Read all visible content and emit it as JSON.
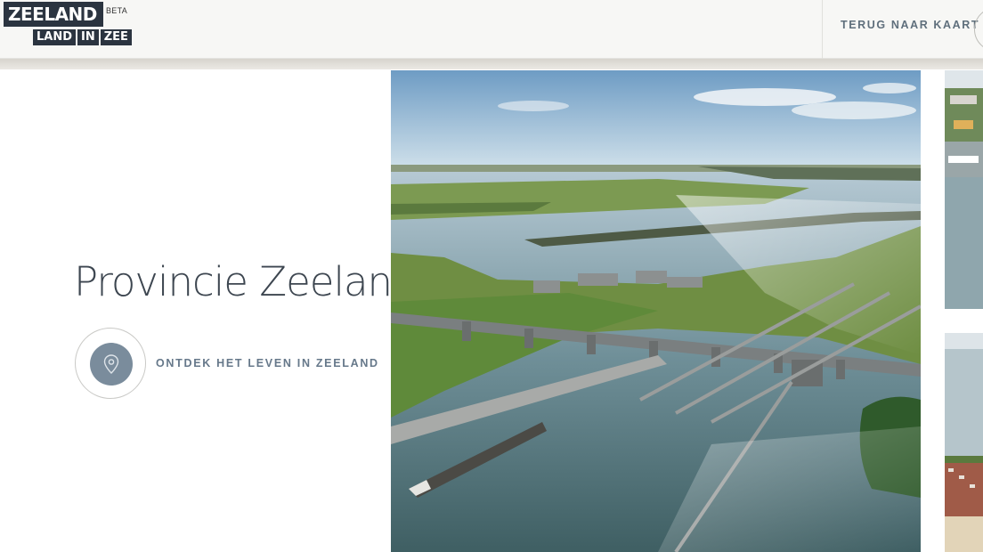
{
  "header": {
    "logo": {
      "top": "ZEELAND",
      "beta": "BETA",
      "words": [
        "LAND",
        "IN",
        "ZEE"
      ]
    },
    "back_link": "TERUG NAAR KAART"
  },
  "main": {
    "title": "Provincie Zeeland",
    "discover": {
      "label": "ONTDEK HET LEVEN IN ZEELAND",
      "icon": "map-pin-icon"
    }
  },
  "photos": [
    {
      "subject": "aerial-sea-locks"
    },
    {
      "subject": "aerial-harbour"
    },
    {
      "subject": "aerial-beach-town"
    }
  ],
  "colors": {
    "accent": "#66788a",
    "logo": "#2b3440",
    "pin_circle": "#7a8c9c"
  }
}
